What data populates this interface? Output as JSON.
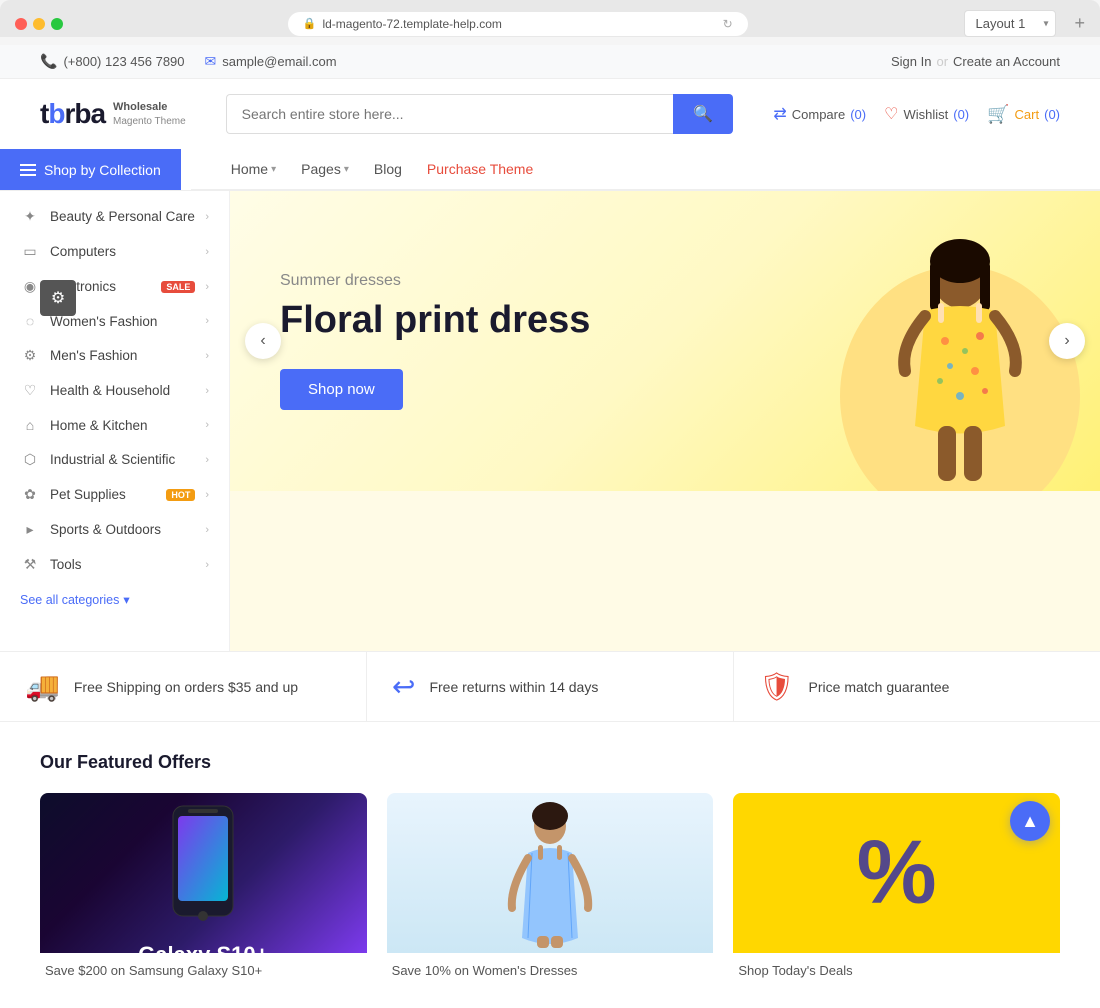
{
  "browser": {
    "url": "ld-magento-72.template-help.com",
    "layout_label": "Layout 1",
    "add_tab": "+"
  },
  "topbar": {
    "phone": "(+800) 123 456 7890",
    "email": "sample@email.com",
    "sign_in": "Sign In",
    "or": "or",
    "create_account": "Create an Account"
  },
  "header": {
    "logo_text": "tbrba",
    "logo_line1": "Wholesale",
    "logo_line2": "Magento Theme",
    "search_placeholder": "Search entire store here...",
    "compare_label": "Compare",
    "compare_count": "(0)",
    "wishlist_label": "Wishlist",
    "wishlist_count": "(0)",
    "cart_label": "Cart",
    "cart_count": "(0)"
  },
  "nav": {
    "shop_by_label": "Shop by Collection",
    "items": [
      {
        "label": "Home",
        "has_arrow": true
      },
      {
        "label": "Pages",
        "has_arrow": true
      },
      {
        "label": "Blog",
        "has_arrow": false
      },
      {
        "label": "Purchase Theme",
        "has_arrow": false,
        "active": true
      }
    ]
  },
  "sidebar": {
    "items": [
      {
        "label": "Beauty & Personal Care",
        "icon": "✦",
        "has_arrow": true,
        "badge": null
      },
      {
        "label": "Computers",
        "icon": "▭",
        "has_arrow": true,
        "badge": null
      },
      {
        "label": "Electronics",
        "icon": "◉",
        "has_arrow": true,
        "badge": "sale"
      },
      {
        "label": "Women's Fashion",
        "icon": "◌",
        "has_arrow": true,
        "badge": null
      },
      {
        "label": "Men's Fashion",
        "icon": "⚙",
        "has_arrow": true,
        "badge": null
      },
      {
        "label": "Health & Household",
        "icon": "♡",
        "has_arrow": true,
        "badge": null
      },
      {
        "label": "Home & Kitchen",
        "icon": "⌂",
        "has_arrow": true,
        "badge": null
      },
      {
        "label": "Industrial & Scientific",
        "icon": "⬡",
        "has_arrow": true,
        "badge": null
      },
      {
        "label": "Pet Supplies",
        "icon": "✿",
        "has_arrow": true,
        "badge": "hot"
      },
      {
        "label": "Sports & Outdoors",
        "icon": "▸",
        "has_arrow": true,
        "badge": null
      },
      {
        "label": "Tools",
        "icon": "⚒",
        "has_arrow": true,
        "badge": null
      }
    ],
    "see_all": "See all categories"
  },
  "hero": {
    "subtitle": "Summer dresses",
    "title": "Floral print dress",
    "btn_label": "Shop now",
    "prev_arrow": "‹",
    "next_arrow": "›"
  },
  "benefits": [
    {
      "icon": "🚚",
      "text": "Free Shipping on orders $35 and up"
    },
    {
      "icon": "↩",
      "text": "Free returns within 14 days"
    },
    {
      "icon": "🛡",
      "text": "Price match guarantee"
    }
  ],
  "featured": {
    "section_title": "Our Featured Offers",
    "cards": [
      {
        "label": "Save $200 on Samsung Galaxy S10+",
        "type": "galaxy"
      },
      {
        "label": "Save 10% on Women's Dresses",
        "type": "women"
      },
      {
        "label": "Shop Today's Deals",
        "type": "percent"
      }
    ]
  },
  "icons": {
    "phone": "📞",
    "email": "✉",
    "search": "🔍",
    "compare": "⇄",
    "wishlist": "♡",
    "cart": "🛒",
    "gear": "⚙",
    "chevron_up": "▲"
  }
}
